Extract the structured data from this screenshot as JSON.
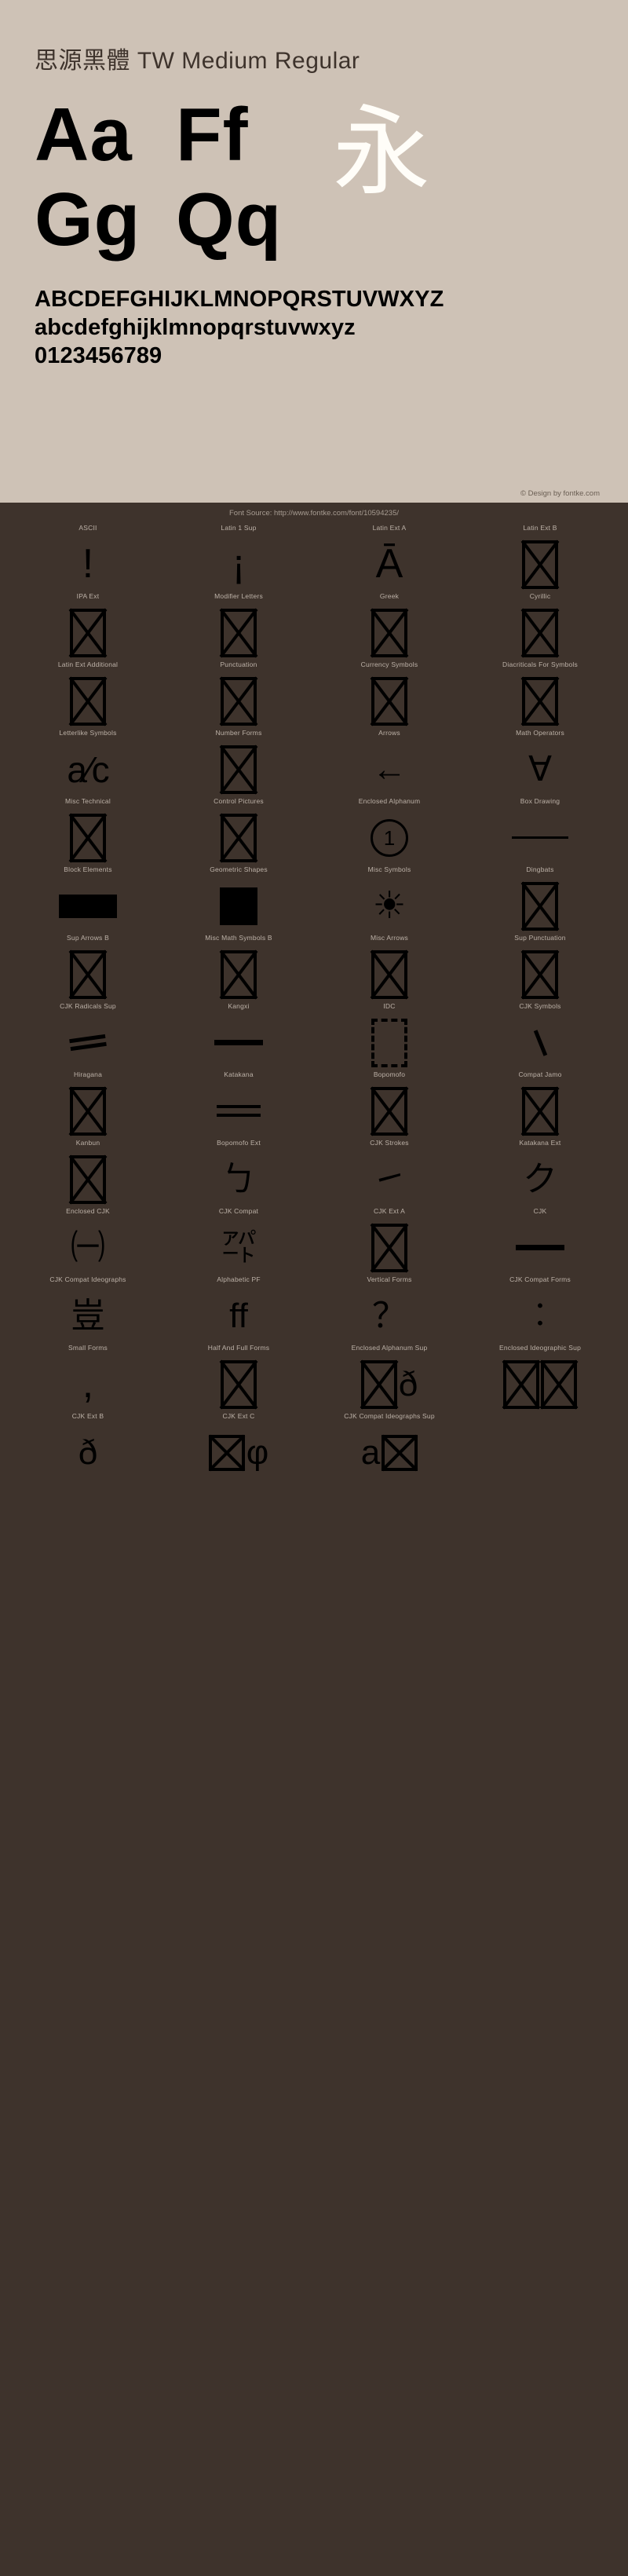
{
  "specimen": {
    "font_title": "思源黑體 TW Medium Regular",
    "sample_pairs": [
      "Aa",
      "Gg",
      "Ff",
      "Qq"
    ],
    "cjk_sample": "永",
    "alphabet_upper": "ABCDEFGHIJKLMNOPQRSTUVWXYZ",
    "alphabet_lower": "abcdefghijklmnopqrstuvwxyz",
    "digits": "0123456789",
    "copyright": "© Design by fontke.com",
    "font_source": "Font Source: http://www.fontke.com/font/10594235/",
    "colors": {
      "panel_bg": "#cec2b6",
      "page_bg": "#3e332c",
      "glyph_ink": "#000000",
      "title_ink": "#3e332c",
      "label_ink": "#bdb2a8",
      "cjk_ink": "#fffdf8"
    }
  },
  "blocks": [
    {
      "label": "ASCII",
      "sample": "!",
      "kind": "big"
    },
    {
      "label": "Latin 1 Sup",
      "sample": "¡",
      "kind": "big"
    },
    {
      "label": "Latin Ext A",
      "sample": "Ā",
      "kind": "big"
    },
    {
      "label": "Latin Ext B",
      "sample": "",
      "kind": "notdef"
    },
    {
      "label": "IPA Ext",
      "sample": "",
      "kind": "notdef"
    },
    {
      "label": "Modifier Letters",
      "sample": "",
      "kind": "notdef"
    },
    {
      "label": "Greek",
      "sample": "",
      "kind": "notdef"
    },
    {
      "label": "Cyrillic",
      "sample": "",
      "kind": "notdef"
    },
    {
      "label": "Latin Ext Additional",
      "sample": "",
      "kind": "notdef"
    },
    {
      "label": "Punctuation",
      "sample": "",
      "kind": "notdef"
    },
    {
      "label": "Currency Symbols",
      "sample": "",
      "kind": "notdef"
    },
    {
      "label": "Diacriticals For Symbols",
      "sample": "",
      "kind": "notdef"
    },
    {
      "label": "Letterlike Symbols",
      "sample": "a⁄c",
      "kind": "wide"
    },
    {
      "label": "Number Forms",
      "sample": "",
      "kind": "notdef"
    },
    {
      "label": "Arrows",
      "sample": "←",
      "kind": "arrow"
    },
    {
      "label": "Math Operators",
      "sample": "∀",
      "kind": "med"
    },
    {
      "label": "Misc Technical",
      "sample": "",
      "kind": "notdef"
    },
    {
      "label": "Control Pictures",
      "sample": "",
      "kind": "notdef"
    },
    {
      "label": "Enclosed Alphanum",
      "sample": "1",
      "kind": "circled"
    },
    {
      "label": "Box Drawing",
      "sample": "─",
      "kind": "longdash"
    },
    {
      "label": "Block Elements",
      "sample": "▬",
      "kind": "blkblock"
    },
    {
      "label": "Geometric Shapes",
      "sample": "■",
      "kind": "blksquare"
    },
    {
      "label": "Misc Symbols",
      "sample": "☀",
      "kind": "sun"
    },
    {
      "label": "Dingbats",
      "sample": "",
      "kind": "notdef"
    },
    {
      "label": "Sup Arrows B",
      "sample": "",
      "kind": "notdef"
    },
    {
      "label": "Misc Math Symbols B",
      "sample": "",
      "kind": "notdef"
    },
    {
      "label": "Misc Arrows",
      "sample": "",
      "kind": "notdef"
    },
    {
      "label": "Sup Punctuation",
      "sample": "",
      "kind": "notdef"
    },
    {
      "label": "CJK Radicals Sup",
      "sample": "⺀",
      "kind": "tilde"
    },
    {
      "label": "Kangxi",
      "sample": "一",
      "kind": "thickdash"
    },
    {
      "label": "IDC",
      "sample": "",
      "kind": "notdef-dashed"
    },
    {
      "label": "CJK Symbols",
      "sample": "、",
      "kind": "backslash"
    },
    {
      "label": "Hiragana",
      "sample": "",
      "kind": "notdef"
    },
    {
      "label": "Katakana",
      "sample": "=",
      "kind": "eqlines"
    },
    {
      "label": "Bopomofo",
      "sample": "",
      "kind": "notdef"
    },
    {
      "label": "Compat Jamo",
      "sample": "",
      "kind": "notdef"
    },
    {
      "label": "Kanbun",
      "sample": "",
      "kind": "notdef"
    },
    {
      "label": "Bopomofo Ext",
      "sample": "ㄅ",
      "kind": "med"
    },
    {
      "label": "CJK Strokes",
      "sample": "㇀",
      "kind": "med"
    },
    {
      "label": "Katakana Ext",
      "sample": "ク",
      "kind": "med"
    },
    {
      "label": "Enclosed CJK",
      "sample": "㈠",
      "kind": "med"
    },
    {
      "label": "CJK Compat",
      "sample": "㌀",
      "kind": "med"
    },
    {
      "label": "CJK Ext A",
      "sample": "",
      "kind": "notdef"
    },
    {
      "label": "CJK",
      "sample": "一",
      "kind": "thickdash"
    },
    {
      "label": "CJK Compat Ideographs",
      "sample": "豈",
      "kind": "med"
    },
    {
      "label": "Alphabetic PF",
      "sample": "ff",
      "kind": "med"
    },
    {
      "label": "Vertical Forms",
      "sample": "？",
      "kind": "med"
    },
    {
      "label": "CJK Compat Forms",
      "sample": "︰",
      "kind": "med"
    },
    {
      "label": "Small Forms",
      "sample": ",",
      "kind": "big"
    },
    {
      "label": "Half And Full Forms",
      "sample": "",
      "kind": "notdef"
    },
    {
      "label": "Enclosed Alphanum Sup",
      "sample": "ð",
      "kind": "notdef-overlay"
    },
    {
      "label": "Enclosed Ideographic Sup",
      "sample": "",
      "kind": "notdef-overlay2"
    },
    {
      "label": "CJK Ext B",
      "sample": "ð",
      "kind": "med"
    },
    {
      "label": "CJK Ext C",
      "sample": "",
      "kind": "notdef-overlay3"
    },
    {
      "label": "CJK Compat Ideographs Sup",
      "sample": "",
      "kind": "notdef-overlay4"
    },
    {
      "label": "",
      "sample": "",
      "kind": "empty"
    }
  ]
}
